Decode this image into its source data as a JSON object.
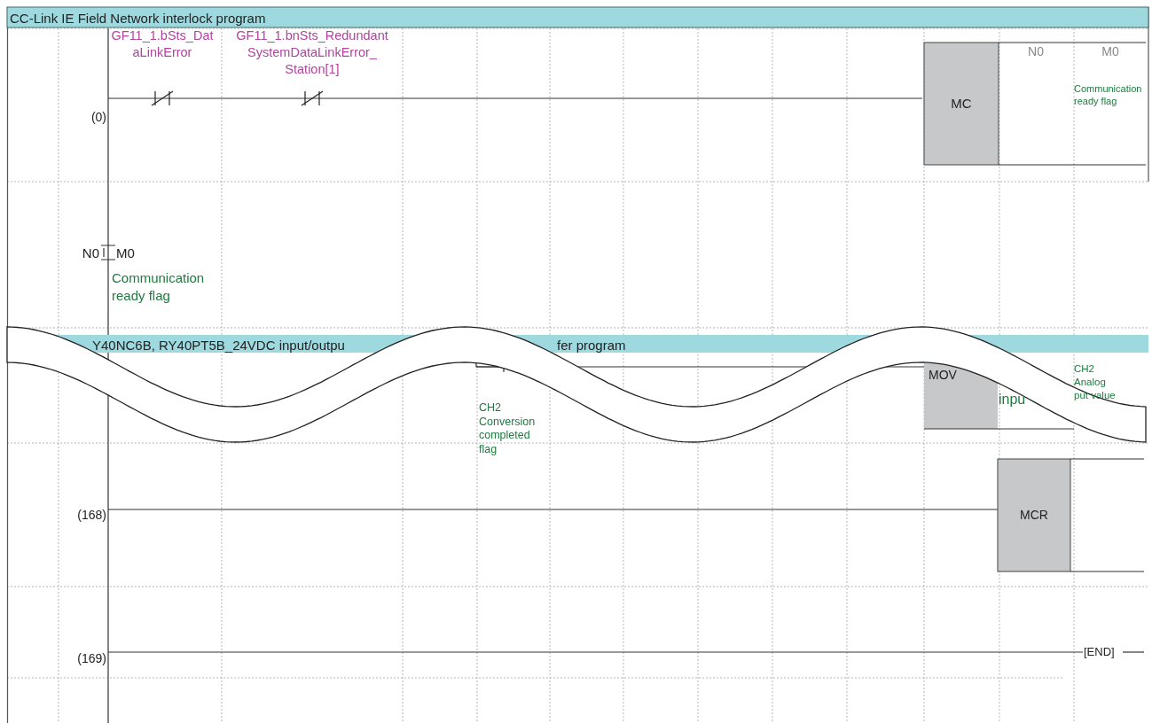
{
  "section_1": {
    "title": "CC-Link IE Field Network interlock program"
  },
  "rung_0": {
    "step": "(0)",
    "contacts": [
      {
        "kind": "normally-closed",
        "label": [
          "GF11_1.bSts_Dat",
          "aLinkError"
        ]
      },
      {
        "kind": "normally-closed",
        "label": [
          "GF11_1.bnSts_Redundant",
          "SystemDataLinkError_",
          "Station[1]"
        ]
      }
    ],
    "instruction": "MC",
    "operands": [
      "N0",
      "M0"
    ],
    "comment": [
      "Communication",
      "ready flag"
    ]
  },
  "nesting": {
    "nest": "N0",
    "device": "M0",
    "comment": [
      "Communication",
      "ready flag"
    ]
  },
  "section_2": {
    "title_fragments": [
      "Y40NC6B, RY40PT5B_24VDC input/outpu",
      "fer program"
    ]
  },
  "rung_partial": {
    "contact_comment": [
      "CH2",
      "Conversion",
      "completed",
      "flag"
    ],
    "instruction": "MOV",
    "operand_fragment": "inpu",
    "destination_comment": [
      "CH2",
      "Analog",
      "put value"
    ]
  },
  "rung_168": {
    "step": "(168)",
    "instruction": "MCR"
  },
  "rung_169": {
    "step": "(169)",
    "instruction": "[END]"
  }
}
